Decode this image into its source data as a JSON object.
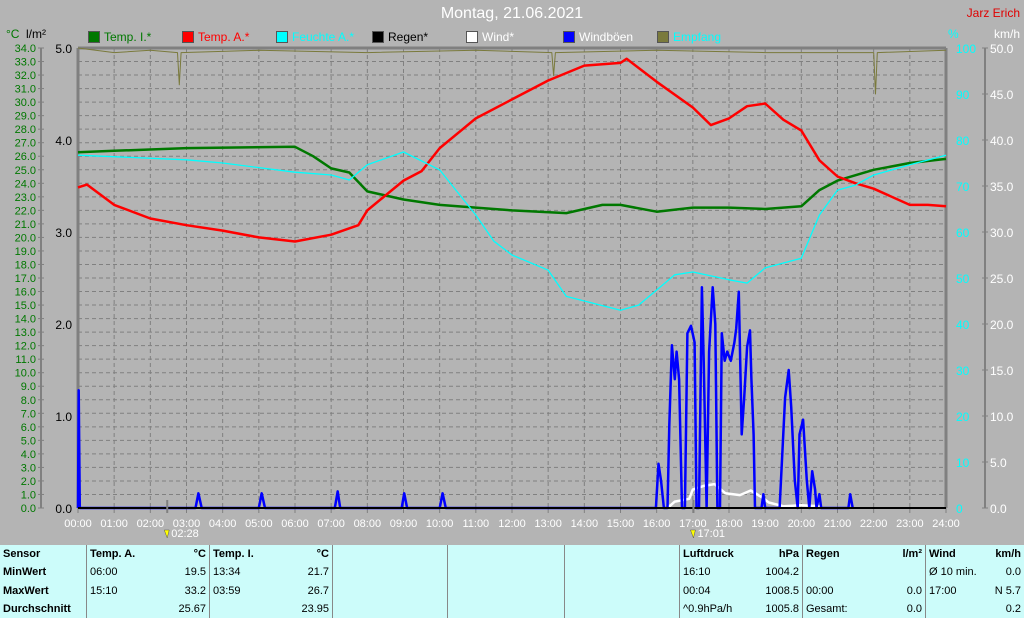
{
  "header": {
    "title": "Montag, 21.06.2021",
    "author": "Jarz Erich"
  },
  "legend": [
    {
      "label": "Temp. I.*",
      "color": "#007800",
      "text_color": "#007800"
    },
    {
      "label": "Temp. A.*",
      "color": "#ff0000",
      "text_color": "#ff0000"
    },
    {
      "label": "Feuchte A.*",
      "color": "#00ffff",
      "text_color": "#00ffff"
    },
    {
      "label": "Regen*",
      "color": "#000000",
      "text_color": "#000000"
    },
    {
      "label": "Wind*",
      "color": "#ffffff",
      "text_color": "#ffffff"
    },
    {
      "label": "Windböen",
      "color": "#0000ff",
      "text_color": "#ffffff"
    },
    {
      "label": "Empfang",
      "color": "#7a7a3c",
      "text_color": "#00ffff"
    }
  ],
  "axes_units": {
    "temp": "°C",
    "rain": "l/m²",
    "humidity": "%",
    "wind": "km/h"
  },
  "chart_data": {
    "type": "line",
    "title": "Montag, 21.06.2021",
    "x_unit": "hours",
    "xlim": [
      0,
      24
    ],
    "x_ticks": [
      "00:00",
      "01:00",
      "02:00",
      "03:00",
      "04:00",
      "05:00",
      "06:00",
      "07:00",
      "08:00",
      "09:00",
      "10:00",
      "11:00",
      "12:00",
      "13:00",
      "14:00",
      "15:00",
      "16:00",
      "17:00",
      "18:00",
      "19:00",
      "20:00",
      "21:00",
      "22:00",
      "23:00",
      "24:00"
    ],
    "y_axes": {
      "temp": {
        "range": [
          0,
          34
        ],
        "ticks": [
          "0.0",
          "1.0",
          "2.0",
          "3.0",
          "4.0",
          "5.0",
          "6.0",
          "7.0",
          "8.0",
          "9.0",
          "10.0",
          "11.0",
          "12.0",
          "13.0",
          "14.0",
          "15.0",
          "16.0",
          "17.0",
          "18.0",
          "19.0",
          "20.0",
          "21.0",
          "22.0",
          "23.0",
          "24.0",
          "25.0",
          "26.0",
          "27.0",
          "28.0",
          "29.0",
          "30.0",
          "31.0",
          "32.0",
          "33.0",
          "34.0"
        ]
      },
      "rain": {
        "range": [
          0,
          5
        ],
        "ticks": [
          "0.0",
          "1.0",
          "2.0",
          "3.0",
          "4.0",
          "5.0"
        ]
      },
      "humidity": {
        "range": [
          0,
          100
        ],
        "ticks": [
          "0",
          "10",
          "20",
          "30",
          "40",
          "50",
          "60",
          "70",
          "80",
          "90",
          "100"
        ]
      },
      "wind": {
        "range": [
          0,
          50
        ],
        "ticks": [
          "0.0",
          "5.0",
          "10.0",
          "15.0",
          "20.0",
          "25.0",
          "30.0",
          "35.0",
          "40.0",
          "45.0",
          "50.0"
        ]
      }
    },
    "grid": true,
    "series": [
      {
        "name": "Temp. I.*",
        "axis": "temp",
        "color": "#007800",
        "points": [
          [
            0,
            26.3
          ],
          [
            1,
            26.4
          ],
          [
            3,
            26.6
          ],
          [
            6,
            26.7
          ],
          [
            6.5,
            26.0
          ],
          [
            7,
            25.1
          ],
          [
            7.5,
            24.8
          ],
          [
            8,
            23.4
          ],
          [
            9,
            22.8
          ],
          [
            10,
            22.4
          ],
          [
            11,
            22.2
          ],
          [
            12,
            22.0
          ],
          [
            13.5,
            21.8
          ],
          [
            14.5,
            22.4
          ],
          [
            15,
            22.4
          ],
          [
            16,
            21.9
          ],
          [
            17,
            22.2
          ],
          [
            18,
            22.2
          ],
          [
            19,
            22.1
          ],
          [
            20,
            22.3
          ],
          [
            20.5,
            23.5
          ],
          [
            21,
            24.2
          ],
          [
            22,
            25.0
          ],
          [
            23,
            25.5
          ],
          [
            24,
            25.8
          ]
        ]
      },
      {
        "name": "Temp. A.*",
        "axis": "temp",
        "color": "#ff0000",
        "points": [
          [
            0,
            23.7
          ],
          [
            0.25,
            23.9
          ],
          [
            1,
            22.4
          ],
          [
            2,
            21.4
          ],
          [
            3,
            20.9
          ],
          [
            4,
            20.5
          ],
          [
            5,
            20.0
          ],
          [
            6,
            19.7
          ],
          [
            7,
            20.2
          ],
          [
            7.75,
            20.9
          ],
          [
            8,
            22.0
          ],
          [
            9,
            24.2
          ],
          [
            9.5,
            24.9
          ],
          [
            10,
            26.6
          ],
          [
            11,
            28.8
          ],
          [
            12,
            30.2
          ],
          [
            13,
            31.6
          ],
          [
            14,
            32.7
          ],
          [
            15,
            32.9
          ],
          [
            15.17,
            33.2
          ],
          [
            16,
            31.5
          ],
          [
            17,
            29.6
          ],
          [
            17.5,
            28.3
          ],
          [
            18,
            28.8
          ],
          [
            18.5,
            29.7
          ],
          [
            19,
            29.9
          ],
          [
            19.5,
            28.7
          ],
          [
            20,
            27.9
          ],
          [
            20.5,
            25.7
          ],
          [
            21,
            24.5
          ],
          [
            21.5,
            24.0
          ],
          [
            22,
            23.6
          ],
          [
            23,
            22.4
          ],
          [
            23.5,
            22.4
          ],
          [
            24,
            22.3
          ]
        ]
      },
      {
        "name": "Feuchte A.*",
        "axis": "humidity",
        "color": "#00ffff",
        "points": [
          [
            0,
            76.7
          ],
          [
            3,
            75.7
          ],
          [
            4,
            75.0
          ],
          [
            6,
            73.0
          ],
          [
            7,
            72.4
          ],
          [
            7.5,
            71.3
          ],
          [
            8,
            74.6
          ],
          [
            9,
            77.4
          ],
          [
            10,
            73.5
          ],
          [
            11,
            63.7
          ],
          [
            11.5,
            58.0
          ],
          [
            12,
            55.0
          ],
          [
            13,
            51.7
          ],
          [
            13.5,
            46.0
          ],
          [
            14,
            45.0
          ],
          [
            15,
            43.0
          ],
          [
            15.5,
            44.1
          ],
          [
            16,
            47.4
          ],
          [
            16.5,
            50.7
          ],
          [
            17,
            51.3
          ],
          [
            18,
            49.6
          ],
          [
            18.5,
            48.9
          ],
          [
            19,
            52.2
          ],
          [
            20,
            54.3
          ],
          [
            20.5,
            63.7
          ],
          [
            21,
            69.1
          ],
          [
            21.5,
            70.2
          ],
          [
            22,
            72.4
          ],
          [
            23,
            74.6
          ],
          [
            24,
            76.7
          ]
        ]
      },
      {
        "name": "Empfang",
        "axis": "humidity",
        "color": "#7a7a3c",
        "points": [
          [
            0,
            100
          ],
          [
            1,
            99
          ],
          [
            2,
            99.5
          ],
          [
            2.75,
            99
          ],
          [
            2.8,
            92
          ],
          [
            2.85,
            99
          ],
          [
            5,
            99.5
          ],
          [
            8,
            99
          ],
          [
            11,
            99.5
          ],
          [
            13.1,
            99
          ],
          [
            13.15,
            94
          ],
          [
            13.2,
            99
          ],
          [
            16,
            99.5
          ],
          [
            19,
            99
          ],
          [
            22,
            99
          ],
          [
            22.05,
            90
          ],
          [
            22.1,
            99
          ],
          [
            24,
            99.5
          ]
        ]
      },
      {
        "name": "Wind*",
        "axis": "wind",
        "color": "#ffffff",
        "points": [
          [
            16.3,
            0
          ],
          [
            16.5,
            0.7
          ],
          [
            16.9,
            1.0
          ],
          [
            17.0,
            2.0
          ],
          [
            17.3,
            2.4
          ],
          [
            17.6,
            2.6
          ],
          [
            17.9,
            1.6
          ],
          [
            18.3,
            1.4
          ],
          [
            18.6,
            1.9
          ],
          [
            18.9,
            1.2
          ],
          [
            19.1,
            0.6
          ],
          [
            19.5,
            0.2
          ],
          [
            20,
            0.3
          ],
          [
            20.5,
            0.2
          ],
          [
            20.55,
            0
          ]
        ]
      },
      {
        "name": "Windböen",
        "axis": "wind",
        "color": "#0000ff",
        "points": [
          [
            0,
            0
          ],
          [
            0.02,
            12.8
          ],
          [
            0.05,
            0
          ],
          [
            3.25,
            0
          ],
          [
            3.33,
            1.6
          ],
          [
            3.42,
            0
          ],
          [
            5.0,
            0
          ],
          [
            5.08,
            1.6
          ],
          [
            5.17,
            0
          ],
          [
            7.1,
            0
          ],
          [
            7.18,
            1.8
          ],
          [
            7.25,
            0
          ],
          [
            8.95,
            0
          ],
          [
            9.02,
            1.6
          ],
          [
            9.1,
            0
          ],
          [
            10.0,
            0
          ],
          [
            10.08,
            1.6
          ],
          [
            10.17,
            0
          ],
          [
            15.98,
            0
          ],
          [
            16.05,
            4.8
          ],
          [
            16.12,
            3
          ],
          [
            16.2,
            0
          ],
          [
            16.3,
            0
          ],
          [
            16.35,
            9
          ],
          [
            16.42,
            17.7
          ],
          [
            16.5,
            14
          ],
          [
            16.55,
            17
          ],
          [
            16.62,
            14
          ],
          [
            16.7,
            0
          ],
          [
            16.78,
            0
          ],
          [
            16.85,
            19
          ],
          [
            16.95,
            19.8
          ],
          [
            17.05,
            18
          ],
          [
            17.1,
            0
          ],
          [
            17.17,
            0
          ],
          [
            17.25,
            24
          ],
          [
            17.3,
            16
          ],
          [
            17.38,
            0
          ],
          [
            17.45,
            17
          ],
          [
            17.55,
            24
          ],
          [
            17.62,
            20
          ],
          [
            17.68,
            0
          ],
          [
            17.75,
            0
          ],
          [
            17.8,
            19
          ],
          [
            17.88,
            16
          ],
          [
            17.95,
            17
          ],
          [
            18.05,
            16
          ],
          [
            18.15,
            18
          ],
          [
            18.2,
            19.5
          ],
          [
            18.27,
            23.5
          ],
          [
            18.35,
            8
          ],
          [
            18.42,
            12
          ],
          [
            18.5,
            17.5
          ],
          [
            18.58,
            19.3
          ],
          [
            18.62,
            14
          ],
          [
            18.68,
            8
          ],
          [
            18.72,
            0
          ],
          [
            18.9,
            0
          ],
          [
            18.95,
            1.5
          ],
          [
            19.0,
            0
          ],
          [
            19.4,
            0
          ],
          [
            19.55,
            12
          ],
          [
            19.65,
            15
          ],
          [
            19.72,
            11
          ],
          [
            19.82,
            3
          ],
          [
            19.9,
            0
          ],
          [
            19.95,
            8
          ],
          [
            20.05,
            9.6
          ],
          [
            20.15,
            3
          ],
          [
            20.22,
            0
          ],
          [
            20.3,
            4
          ],
          [
            20.38,
            2
          ],
          [
            20.42,
            0
          ],
          [
            20.5,
            1.5
          ],
          [
            20.55,
            0
          ],
          [
            21.3,
            0
          ],
          [
            21.35,
            1.5
          ],
          [
            21.42,
            0
          ]
        ]
      }
    ],
    "annotations": [
      {
        "time": 2.467,
        "label": "02:28"
      },
      {
        "time": 17.017,
        "label": "17:01"
      }
    ]
  },
  "stats": {
    "header": [
      "Sensor",
      "Temp. A.",
      "°C",
      "Temp. I.",
      "°C",
      "Luftdruck",
      "hPa",
      "Regen",
      "l/m²",
      "Wind",
      "km/h"
    ],
    "rows": [
      {
        "label": "MinWert",
        "ta_time": "06:00",
        "ta_val": "19.5",
        "ti_time": "13:34",
        "ti_val": "21.7",
        "p_time": "16:10",
        "p_val": "1004.2",
        "r_time": "",
        "r_val": "",
        "w_time": "Ø 10 min.",
        "w_val": "0.0"
      },
      {
        "label": "MaxWert",
        "ta_time": "15:10",
        "ta_val": "33.2",
        "ti_time": "03:59",
        "ti_val": "26.7",
        "p_time": "00:04",
        "p_val": "1008.5",
        "r_time": "00:00",
        "r_val": "0.0",
        "w_time": "17:00",
        "w_val": "N 5.7"
      },
      {
        "label": "Durchschnitt",
        "ta_time": "",
        "ta_val": "25.67",
        "ti_time": "",
        "ti_val": "23.95",
        "p_time": "^0.9hPa/h",
        "p_val": "1005.8",
        "r_time": "Gesamt:",
        "r_val": "0.0",
        "w_time": "",
        "w_val": "0.2"
      }
    ]
  }
}
